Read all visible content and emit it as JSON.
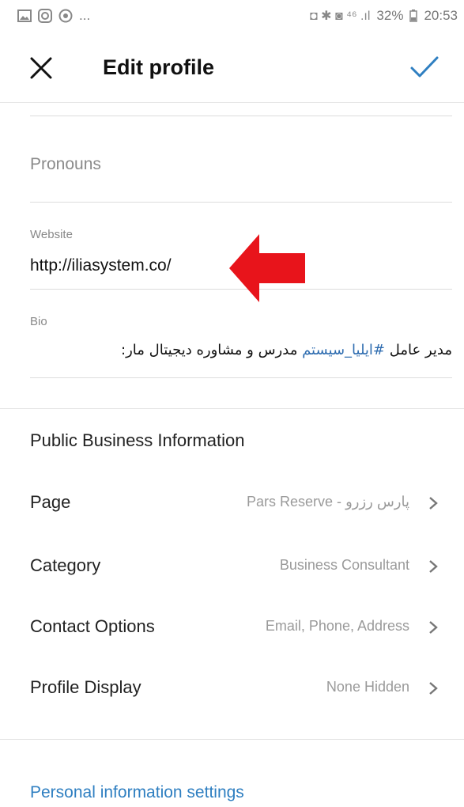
{
  "statusbar": {
    "left_icons": [
      "image-icon",
      "instagram-icon",
      "chrome-icon"
    ],
    "left_more": "...",
    "right_glyphs": "◘ ✱ ◙ ⁴⁶ .ıl",
    "battery": "32%",
    "time": "20:53"
  },
  "header": {
    "title": "Edit profile"
  },
  "fields": {
    "pronouns_placeholder": "Pronouns",
    "website_label": "Website",
    "website_value": "http://iliasystem.co/",
    "bio_label": "Bio",
    "bio_part1": "مدیر عامل ",
    "bio_hashtag": "#ایلیا_سیستم",
    "bio_part2": "  مدرس و مشاوره دیجیتال مار:"
  },
  "business": {
    "section_title": "Public Business Information",
    "rows": [
      {
        "label": "Page",
        "value": "Pars Reserve - پارس رزرو"
      },
      {
        "label": "Category",
        "value": "Business Consultant"
      },
      {
        "label": "Contact Options",
        "value": "Email, Phone, Address"
      },
      {
        "label": "Profile Display",
        "value": "None Hidden"
      }
    ]
  },
  "personal_link": "Personal information settings",
  "colors": {
    "accent_blue": "#2f7fc1",
    "arrow_red": "#e8141b"
  }
}
